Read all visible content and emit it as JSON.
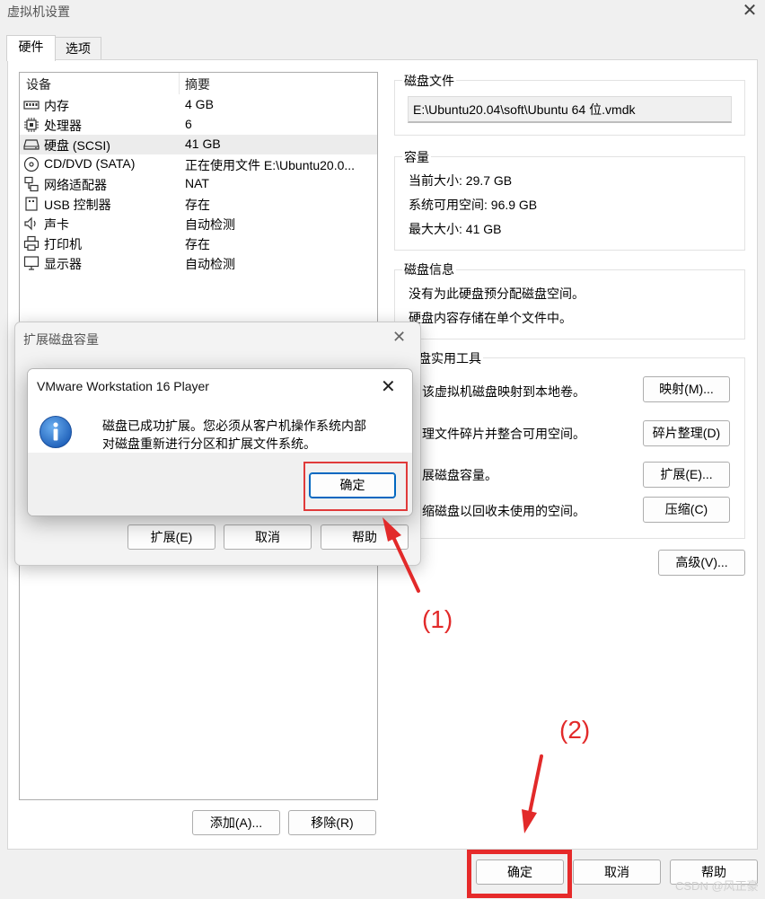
{
  "window": {
    "title": "虚拟机设置",
    "close_glyph": "✕"
  },
  "tabs": [
    {
      "label": "硬件"
    },
    {
      "label": "选项"
    }
  ],
  "device_list": {
    "col_device": "设备",
    "col_summary": "摘要",
    "rows": [
      {
        "name": "内存",
        "summary": "4 GB",
        "icon": "memory-icon"
      },
      {
        "name": "处理器",
        "summary": "6",
        "icon": "processor-icon"
      },
      {
        "name": "硬盘 (SCSI)",
        "summary": "41 GB",
        "icon": "hard-disk-icon"
      },
      {
        "name": "CD/DVD (SATA)",
        "summary": "正在使用文件 E:\\Ubuntu20.0...",
        "icon": "cd-dvd-icon"
      },
      {
        "name": "网络适配器",
        "summary": "NAT",
        "icon": "network-adapter-icon"
      },
      {
        "name": "USB 控制器",
        "summary": "存在",
        "icon": "usb-controller-icon"
      },
      {
        "name": "声卡",
        "summary": "自动检测",
        "icon": "sound-card-icon"
      },
      {
        "name": "打印机",
        "summary": "存在",
        "icon": "printer-icon"
      },
      {
        "name": "显示器",
        "summary": "自动检测",
        "icon": "display-icon"
      }
    ],
    "add_button": "添加(A)...",
    "remove_button": "移除(R)"
  },
  "disk_file": {
    "title": "磁盘文件",
    "path": "E:\\Ubuntu20.04\\soft\\Ubuntu 64 位.vmdk"
  },
  "capacity": {
    "title": "容量",
    "current_size": "当前大小: 29.7 GB",
    "system_available": "系统可用空间: 96.9 GB",
    "max_size": "最大大小: 41 GB"
  },
  "disk_info": {
    "title": "磁盘信息",
    "line1": "没有为此硬盘预分配磁盘空间。",
    "line2": "硬盘内容存储在单个文件中。"
  },
  "disk_utilities": {
    "title": "盘实用工具",
    "items": [
      {
        "text": "该虚拟机磁盘映射到本地卷。",
        "button": "映射(M)..."
      },
      {
        "text": "理文件碎片并整合可用空间。",
        "button": "碎片整理(D)"
      },
      {
        "text": "展磁盘容量。",
        "button": "扩展(E)..."
      },
      {
        "text": "缩磁盘以回收未使用的空间。",
        "button": "压缩(C)"
      }
    ]
  },
  "advanced_button": "高级(V)...",
  "footer": {
    "ok": "确定",
    "cancel": "取消",
    "help": "帮助"
  },
  "expand_dialog": {
    "title": "扩展磁盘容量",
    "close_glyph": "✕",
    "expand_button": "扩展(E)",
    "cancel_button": "取消",
    "help_button": "帮助"
  },
  "message_box": {
    "title": "VMware Workstation 16 Player",
    "close_glyph": "✕",
    "message_line1": "磁盘已成功扩展。您必须从客户机操作系统内部",
    "message_line2": "对磁盘重新进行分区和扩展文件系统。",
    "ok_button": "确定",
    "icon": "info-icon"
  },
  "annotations": {
    "step1": "(1)",
    "step2": "(2)",
    "color": "#e22a2a"
  },
  "watermark": "CSDN @风正豪"
}
